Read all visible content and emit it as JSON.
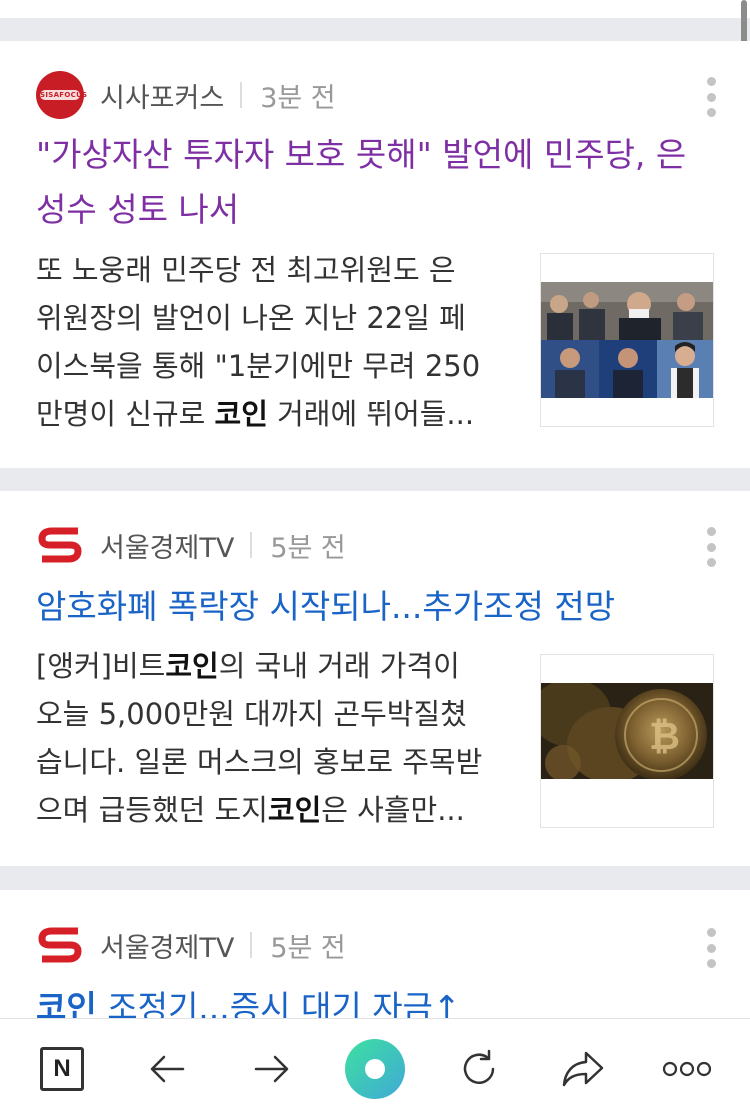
{
  "articles": [
    {
      "source": "시사포커스",
      "time": "3분 전",
      "title_lines": [
        "\"가상자산 투자자 보호 못해\" 발언에 민주당, 은",
        "성수 성토 나서"
      ],
      "snippet_lines": [
        [
          "또 노웅래 민주당 전 최고위원도 은"
        ],
        [
          "위원장의 발언이 나온 지난 22일 페"
        ],
        [
          "이스북을 통해 \"1분기에만 무려 250"
        ],
        [
          "만명이 신규로 ",
          "코인",
          " 거래에 뛰어들..."
        ]
      ],
      "logo_text": "SISAFOCUS"
    },
    {
      "source": "서울경제TV",
      "time": "5분 전",
      "title_lines": [
        "암호화폐 폭락장 시작되나...추가조정 전망"
      ],
      "snippet_lines": [
        [
          "[앵커]비트",
          "코인",
          "의 국내 거래 가격이"
        ],
        [
          "오늘 5,000만원 대까지 곤두박질쳤"
        ],
        [
          "습니다. 일론 머스크의 홍보로 주목받"
        ],
        [
          "으며 급등했던 도지",
          "코인",
          "은 사흘만..."
        ]
      ]
    },
    {
      "source": "서울경제TV",
      "time": "5분 전",
      "title_parts": [
        "코인",
        " 조정기...증시 대기 자금↑"
      ]
    }
  ],
  "colors": {
    "visited_title": "#7e2fa4",
    "link_title": "#1a64c8",
    "sisa_logo": "#c81d25",
    "sen_logo": "#d61f26"
  },
  "toolbar": {
    "home_label": "N"
  }
}
